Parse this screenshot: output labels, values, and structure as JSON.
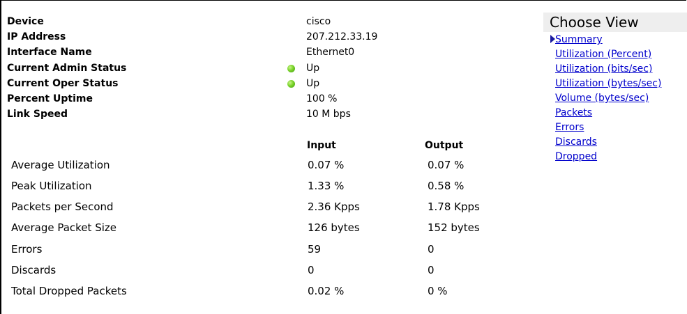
{
  "device_info": {
    "rows": [
      {
        "label": "Device",
        "value": "cisco"
      },
      {
        "label": "IP Address",
        "value": "207.212.33.19"
      },
      {
        "label": "Interface Name",
        "value": "Ethernet0"
      },
      {
        "label": "Current Admin Status",
        "value": "Up"
      },
      {
        "label": "Current Oper Status",
        "value": "Up"
      },
      {
        "label": "Percent Uptime",
        "value": "100 %"
      },
      {
        "label": "Link Speed",
        "value": "10 M bps"
      }
    ],
    "status_color": "#6cc41f"
  },
  "stats": {
    "headers": {
      "input": "Input",
      "output": "Output"
    },
    "rows": [
      {
        "label": "Average Utilization",
        "input": "0.07 %",
        "output": "0.07 %"
      },
      {
        "label": "Peak Utilization",
        "input": "1.33 %",
        "output": "0.58 %"
      },
      {
        "label": "Packets per Second",
        "input": "2.36 Kpps",
        "output": "1.78 Kpps"
      },
      {
        "label": "Average Packet Size",
        "input": "126 bytes",
        "output": "152 bytes"
      },
      {
        "label": "Errors",
        "input": "59",
        "output": "0"
      },
      {
        "label": "Discards",
        "input": "0",
        "output": "0"
      },
      {
        "label": "Total Dropped Packets",
        "input": "0.02 %",
        "output": "0 %"
      }
    ]
  },
  "view_panel": {
    "title": "Choose View",
    "items": [
      "Summary",
      "Utilization (Percent)",
      "Utilization (bits/sec)",
      "Utilization (bytes/sec)",
      "Volume (bytes/sec)",
      "Packets",
      "Errors",
      "Discards",
      "Dropped"
    ],
    "selected": "Summary",
    "link_color": "#0000cc"
  }
}
